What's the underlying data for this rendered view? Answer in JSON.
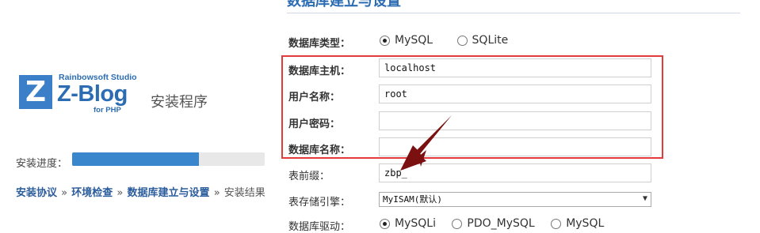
{
  "logo": {
    "letter": "Z",
    "studio": "Rainbowsoft Studio",
    "name": "Z-Blog",
    "for_php": "for PHP",
    "installer": "安装程序"
  },
  "progress": {
    "label": "安装进度：",
    "value": 0.66
  },
  "steps": [
    {
      "label": "安装协议",
      "link": true
    },
    {
      "label": "环境检查",
      "link": true
    },
    {
      "label": "数据库建立与设置",
      "link": true
    },
    {
      "label": "安装结果",
      "link": false
    }
  ],
  "steps_separator": "»",
  "section": {
    "title": "数据库建立与设置"
  },
  "form": {
    "db_type_label": "数据库类型：",
    "db_type_options": [
      {
        "label": "MySQL",
        "selected": true
      },
      {
        "label": "SQLite",
        "selected": false
      }
    ],
    "host_label": "数据库主机：",
    "host_value": "localhost",
    "user_label": "用户名称：",
    "user_value": "root",
    "password_label": "用户密码：",
    "password_value": "",
    "dbname_label": "数据库名称：",
    "dbname_value": "",
    "prefix_label": "表前缀：",
    "prefix_value": "zbp_",
    "engine_label": "表存储引擎：",
    "engine_value": "MyISAM(默认)",
    "driver_label": "数据库驱动：",
    "driver_options": [
      {
        "label": "MySQLi",
        "selected": true
      },
      {
        "label": "PDO_MySQL",
        "selected": false
      },
      {
        "label": "MySQL",
        "selected": false
      }
    ]
  },
  "colors": {
    "brand": "#2c6cb3",
    "highlight": "#e23b3b",
    "arrow": "#7a1010",
    "progress": "#3a86cc"
  },
  "icons": {
    "dropdown": "chevron-down-icon",
    "annotation": "arrow-icon"
  }
}
